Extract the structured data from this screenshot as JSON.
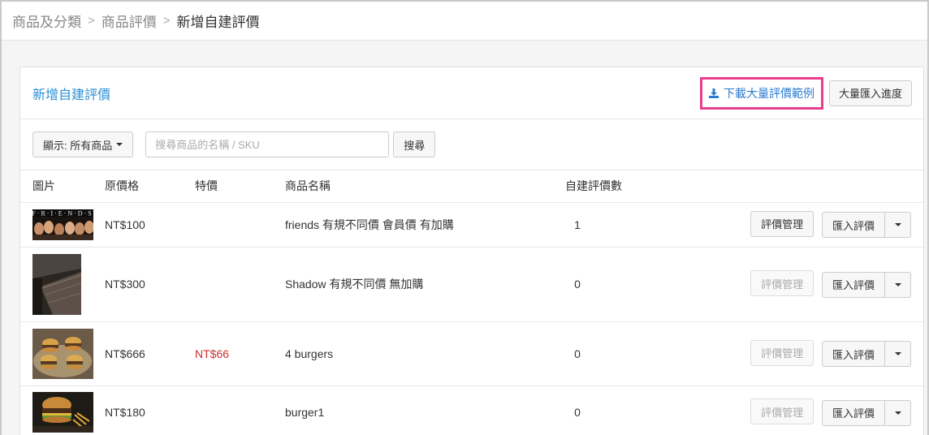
{
  "breadcrumb": [
    "商品及分類",
    "商品評價",
    "新增自建評價"
  ],
  "panel": {
    "title": "新增自建評價",
    "download_label": "下載大量評價範例",
    "progress_label": "大量匯入進度"
  },
  "toolbar": {
    "filter_label": "顯示: 所有商品",
    "search_placeholder": "搜尋商品的名稱 / SKU",
    "search_button": "搜尋"
  },
  "table": {
    "headers": [
      "圖片",
      "原價格",
      "特價",
      "商品名稱",
      "自建評價數"
    ],
    "rows": [
      {
        "price": "NT$100",
        "special": "",
        "name": "friends 有規不同價 會員價 有加購",
        "count": "1",
        "manage_label": "評價管理",
        "manage_enabled": true,
        "import_label": "匯入評價",
        "image": "friends-thumbnail"
      },
      {
        "price": "NT$300",
        "special": "",
        "name": "Shadow 有規不同價 無加購",
        "count": "0",
        "manage_label": "評價管理",
        "manage_enabled": false,
        "import_label": "匯入評價",
        "image": "shadow-thumbnail"
      },
      {
        "price": "NT$666",
        "special": "NT$66",
        "name": "4 burgers",
        "count": "0",
        "manage_label": "評價管理",
        "manage_enabled": false,
        "import_label": "匯入評價",
        "image": "burgers-thumbnail"
      },
      {
        "price": "NT$180",
        "special": "",
        "name": "burger1",
        "count": "0",
        "manage_label": "評價管理",
        "manage_enabled": false,
        "import_label": "匯入評價",
        "image": "burger-thumbnail"
      }
    ]
  },
  "colors": {
    "accent": "#2b8fd6",
    "highlight": "#e83e8c",
    "special_price": "#c9302c"
  }
}
